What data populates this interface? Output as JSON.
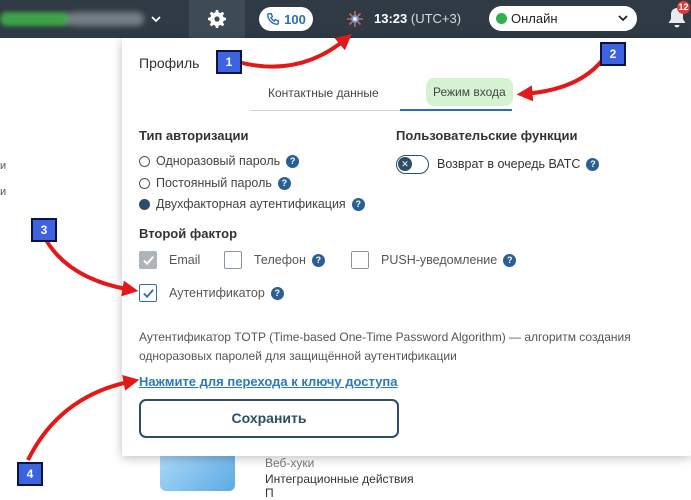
{
  "topbar": {
    "calls_count": "100",
    "time": "13:23",
    "timezone": "(UTC+3)",
    "status": "Онлайн",
    "notifications_count": "12",
    "colors": {
      "bar": "#2f3a44",
      "online": "#2fb24c",
      "badge": "#e23b3b"
    }
  },
  "background": {
    "side_char_1": "и",
    "side_char_2": "и",
    "item_1": "Веб-хуки",
    "item_2": "Интеграционные действия",
    "item_3": "П"
  },
  "modal": {
    "title": "Профиль",
    "tabs": [
      {
        "label": "Контактные данные",
        "active": false
      },
      {
        "label": "Режим входа",
        "active": true
      }
    ],
    "auth_type": {
      "title": "Тип авторизации",
      "options": [
        {
          "label": "Одноразовый пароль",
          "selected": false
        },
        {
          "label": "Постоянный пароль",
          "selected": false
        },
        {
          "label": "Двухфакторная аутентификация",
          "selected": true
        }
      ]
    },
    "user_functions": {
      "title": "Пользовательские функции",
      "toggle_label": "Возврат в очередь ВАТС",
      "toggle_on": false
    },
    "second_factor": {
      "title": "Второй фактор",
      "options": [
        {
          "label": "Email",
          "checked": true,
          "disabled": true
        },
        {
          "label": "Телефон",
          "checked": false,
          "disabled": false
        },
        {
          "label": "PUSH-уведомление",
          "checked": false,
          "disabled": false
        },
        {
          "label": "Аутентификатор",
          "checked": true,
          "disabled": false
        }
      ]
    },
    "description_line1": "Аутентификатор TOTP (Time-based One-Time Password Algorithm) — алгоритм создания",
    "description_line2": "одноразовых паролей для защищённой аутентификации",
    "key_link": "Нажмите для перехода к ключу доступа",
    "save_button": "Сохранить",
    "help_icon_glyph": "?"
  },
  "annotations": {
    "badges": [
      "1",
      "2",
      "3",
      "4"
    ],
    "colors": {
      "arrow": "#e31919",
      "badge_fill": "#3d63e0"
    }
  }
}
